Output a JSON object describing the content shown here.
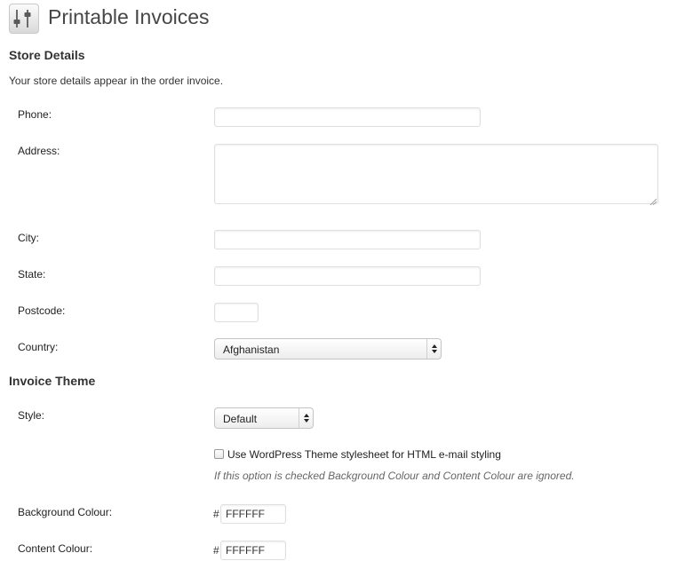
{
  "header": {
    "title": "Printable Invoices",
    "icon": "settings-sliders-icon"
  },
  "store_details": {
    "heading": "Store Details",
    "intro": "Your store details appear in the order invoice.",
    "phone": {
      "label": "Phone:",
      "value": ""
    },
    "address": {
      "label": "Address:",
      "value": ""
    },
    "city": {
      "label": "City:",
      "value": ""
    },
    "state": {
      "label": "State:",
      "value": ""
    },
    "postcode": {
      "label": "Postcode:",
      "value": ""
    },
    "country": {
      "label": "Country:",
      "selected": "Afghanistan"
    }
  },
  "invoice_theme": {
    "heading": "Invoice Theme",
    "style": {
      "label": "Style:",
      "selected": "Default"
    },
    "use_theme_stylesheet": {
      "label": "Use WordPress Theme stylesheet for HTML e-mail styling",
      "checked": false
    },
    "hint": "If this option is checked Background Colour and Content Colour are ignored.",
    "background_colour": {
      "label": "Background Colour:",
      "prefix": "#",
      "value": "FFFFFF"
    },
    "content_colour": {
      "label": "Content Colour:",
      "prefix": "#",
      "value": "FFFFFF"
    }
  }
}
